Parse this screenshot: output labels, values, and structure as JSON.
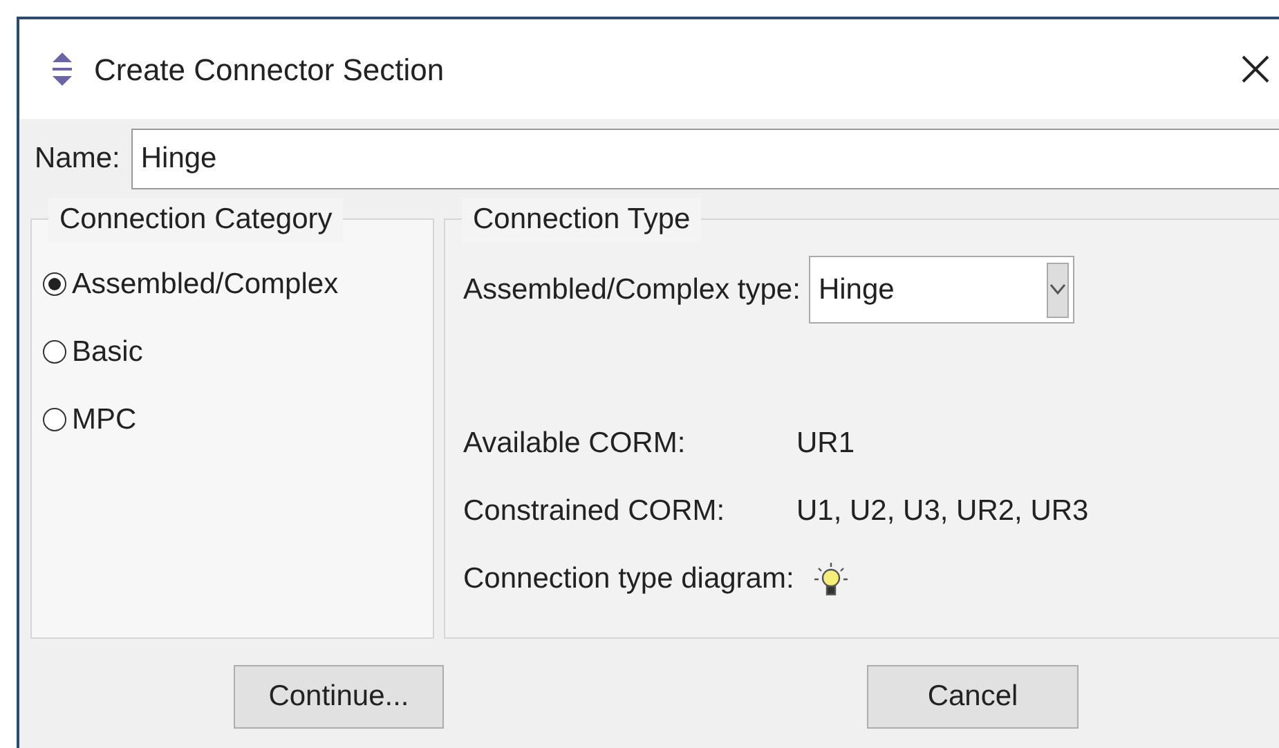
{
  "window": {
    "title": "Create Connector Section"
  },
  "name_field": {
    "label": "Name:",
    "value": "Hinge"
  },
  "category": {
    "title": "Connection Category",
    "options": [
      {
        "label": "Assembled/Complex",
        "selected": true
      },
      {
        "label": "Basic",
        "selected": false
      },
      {
        "label": "MPC",
        "selected": false
      }
    ]
  },
  "type": {
    "title": "Connection Type",
    "type_label": "Assembled/Complex type:",
    "type_value": "Hinge",
    "available_label": "Available CORM:",
    "available_value": "UR1",
    "constrained_label": "Constrained CORM:",
    "constrained_value": "U1, U2, U3, UR2, UR3",
    "diagram_label": "Connection type diagram:"
  },
  "buttons": [
    "Continue...",
    "Cancel"
  ]
}
